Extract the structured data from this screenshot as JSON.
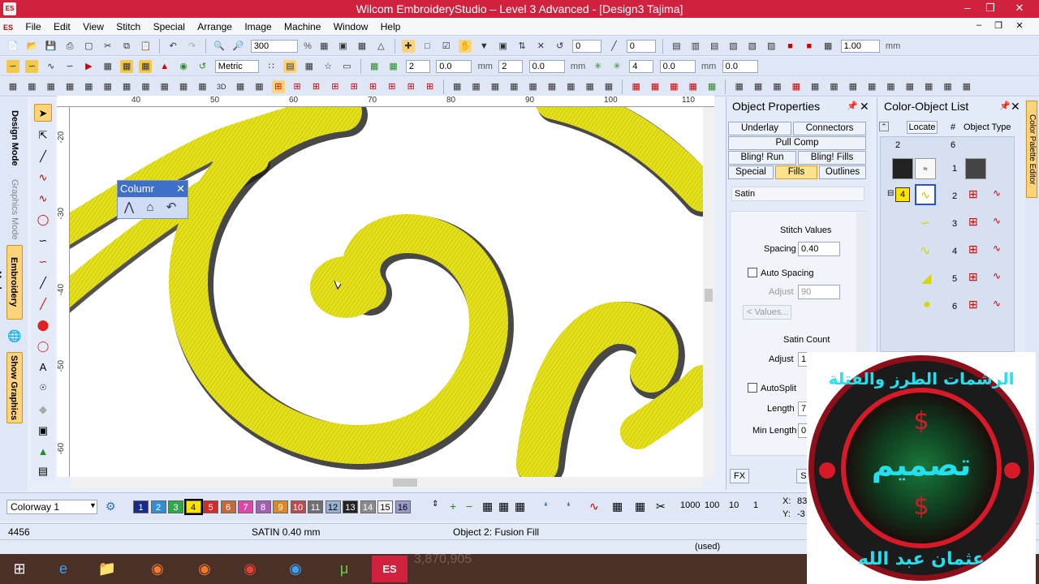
{
  "window": {
    "title": "Wilcom EmbroideryStudio – Level 3 Advanced - [Design3          Tajima]",
    "logo_text": "ES"
  },
  "menu": [
    "File",
    "Edit",
    "View",
    "Stitch",
    "Special",
    "Arrange",
    "Image",
    "Machine",
    "Window",
    "Help"
  ],
  "toolbar": {
    "zoom_value": "300",
    "zoom_unit": "%",
    "rotate_value": "0",
    "slant_value": "0",
    "scale_value": "1.00",
    "scale_unit": "mm",
    "units_select": "Metric",
    "field_a": "2",
    "field_b": "0.0",
    "field_c": "2",
    "field_d": "0.0",
    "field_e": "4",
    "field_f": "0.0",
    "field_g": "0.0",
    "mm_label": "mm"
  },
  "left_tabs": {
    "design_mode": "Design Mode",
    "graphics_mode": "Graphics Mode",
    "embroidery_mode": "Embroidery Mode",
    "show_graphics": "Show Graphics"
  },
  "ruler": {
    "top": [
      "40",
      "50",
      "60",
      "70",
      "80",
      "90",
      "100",
      "110"
    ],
    "left": [
      "-20",
      "-30",
      "-40",
      "-50",
      "-60"
    ]
  },
  "column_toolbar": {
    "title": "Columr"
  },
  "object_properties": {
    "title": "Object Properties",
    "tabs": [
      "Underlay",
      "Connectors",
      "Pull Comp",
      "Bling! Run",
      "Bling! Fills",
      "Special",
      "Fills",
      "Outlines"
    ],
    "fill_type": "Satin",
    "stitch_values_label": "Stitch Values",
    "spacing_label": "Spacing",
    "spacing_value": "0.40",
    "auto_spacing_label": "Auto Spacing",
    "adjust_label": "Adjust",
    "adjust_value": "90",
    "values_button": "Values...",
    "satin_count_label": "Satin Count",
    "satin_adjust_label": "Adjust",
    "satin_adjust_value": "1",
    "autosplit_label": "AutoSplit",
    "length_label": "Length",
    "length_value": "7",
    "min_length_label": "Min Length",
    "min_length_value": "0",
    "fx_button": "FX",
    "save_partial": "Sa"
  },
  "color_object_list": {
    "title": "Color-Object List",
    "locate_button": "Locate",
    "hash_header": "#",
    "object_type_header": "Object Type",
    "col_left": "2",
    "col_right": "6",
    "rows": [
      {
        "index": "1"
      },
      {
        "color_no": "4",
        "index": "2"
      },
      {
        "index": "3"
      },
      {
        "index": "4"
      },
      {
        "index": "5"
      },
      {
        "index": "6"
      }
    ],
    "palette_editor_tab": "Color Palette Editor"
  },
  "palette": {
    "colorway": "Colorway 1",
    "swatches": [
      {
        "n": "1",
        "color": "#1a2a8a"
      },
      {
        "n": "2",
        "color": "#2f8fd6"
      },
      {
        "n": "3",
        "color": "#2fa84a"
      },
      {
        "n": "4",
        "color": "#ffe400"
      },
      {
        "n": "5",
        "color": "#d42a2a"
      },
      {
        "n": "6",
        "color": "#c46a3a"
      },
      {
        "n": "7",
        "color": "#d84aa8"
      },
      {
        "n": "8",
        "color": "#a35fb0"
      },
      {
        "n": "9",
        "color": "#d88a2a"
      },
      {
        "n": "10",
        "color": "#c04a4a"
      },
      {
        "n": "11",
        "color": "#707070"
      },
      {
        "n": "12",
        "color": "#9ab0d0"
      },
      {
        "n": "13",
        "color": "#222222"
      },
      {
        "n": "14",
        "color": "#8a8a8a"
      },
      {
        "n": "15",
        "color": "#f4f4f4"
      },
      {
        "n": "16",
        "color": "#9a9ac8"
      }
    ],
    "numbers": [
      "1000",
      "100",
      "10",
      "1"
    ]
  },
  "status": {
    "stitch_count": "4456",
    "stitch_type": "SATIN  0.40 mm",
    "object_info": "Object 2: Fusion Fill",
    "used": "(used)",
    "x_label": "X:",
    "x_value": "83",
    "y_label": "Y:",
    "y_value": "-3"
  },
  "taskbar": {
    "counter_text": "3,870,905"
  },
  "logo": {
    "top_text": "الرشمات الطرز والفتلة",
    "center_text": "تصميم",
    "bottom_text": "عثمان عبد الله"
  },
  "colors": {
    "title_bar": "#d0213e",
    "embroidery_yellow": "#e8e41c",
    "panel_bg": "#e4ebf8",
    "taskbar": "#4a3026"
  }
}
